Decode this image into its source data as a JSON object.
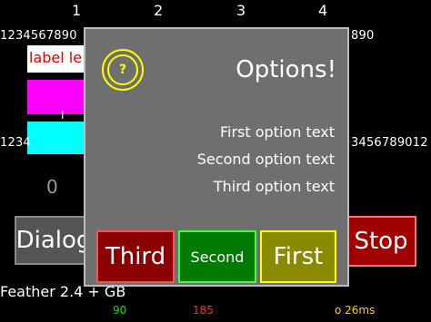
{
  "columns": [
    "1",
    "2",
    "3",
    "4"
  ],
  "background": {
    "digits_top_left": "1234567890",
    "digits_top_right": "890",
    "label_text": "label le",
    "digits_mid_left": "1234",
    "digits_mid_right": "3456789012",
    "value_zero": "0",
    "slider_mark": "I",
    "dialog_button": "Dialog",
    "stop_button": "Stop",
    "footer_text": "Feather 2.4 + GB",
    "stat_green": "90",
    "stat_red": "185",
    "stat_time": "o 26ms"
  },
  "dialog": {
    "title": "Options!",
    "icon_glyph": "?",
    "options": [
      "First option text",
      "Second option text",
      "Third option text"
    ],
    "buttons": {
      "third": "Third",
      "second": "Second",
      "first": "First"
    }
  },
  "colors": {
    "magenta": "#ff00ff",
    "cyan": "#00ffff",
    "dialog_bg": "#6f6f6f",
    "third_btn": "#8b0000",
    "second_btn": "#007a00",
    "first_btn": "#8a8a00",
    "yellow": "#ffff00"
  }
}
